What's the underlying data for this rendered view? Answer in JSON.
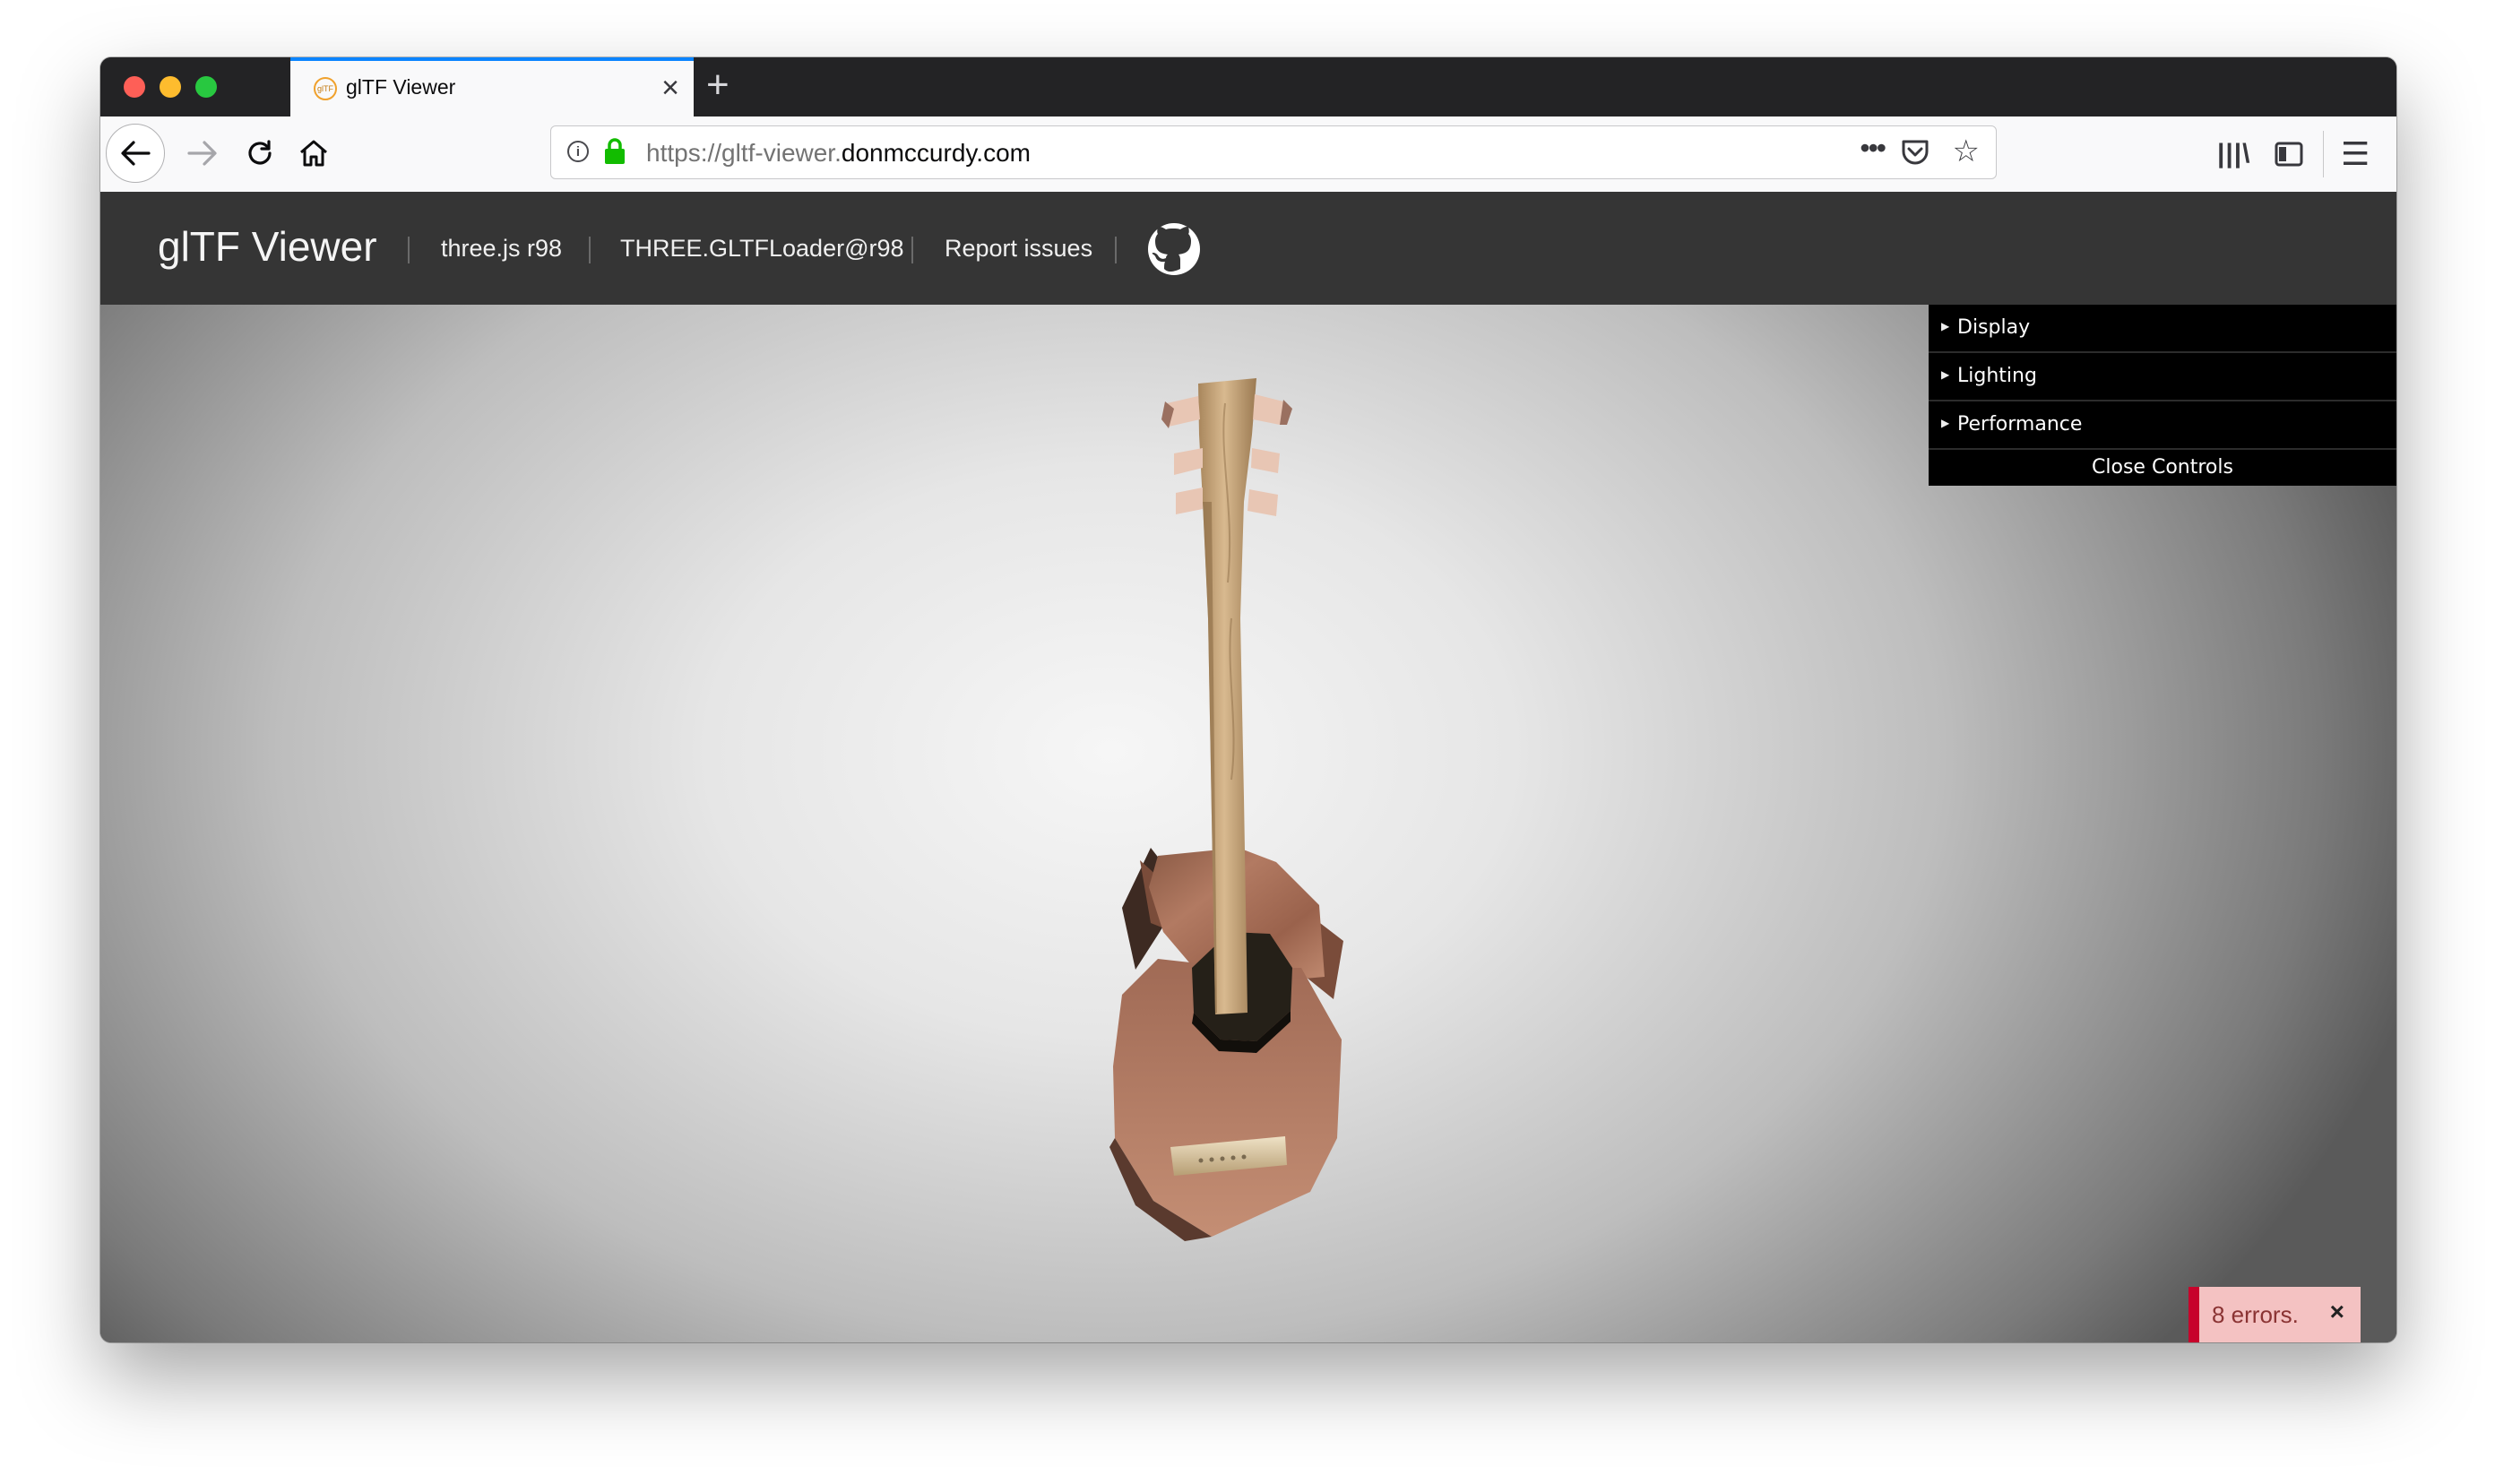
{
  "browser": {
    "tab_title": "glTF Viewer",
    "favicon_text": "glTF",
    "url_prefix": "https://gltf-viewer.",
    "url_domain": "donmccurdy.com"
  },
  "header": {
    "brand": "glTF Viewer",
    "nav": [
      "three.js r98",
      "THREE.GLTFLoader@r98",
      "Report issues"
    ]
  },
  "controls": {
    "folders": [
      "Display",
      "Lighting",
      "Performance"
    ],
    "close_label": "Close Controls"
  },
  "toast": {
    "text": "8 errors.",
    "close": "×"
  },
  "colors": {
    "accent": "#0a84ff",
    "header_bg": "#353535",
    "error_bar": "#c7022b",
    "error_bg": "#f4c2c2"
  }
}
